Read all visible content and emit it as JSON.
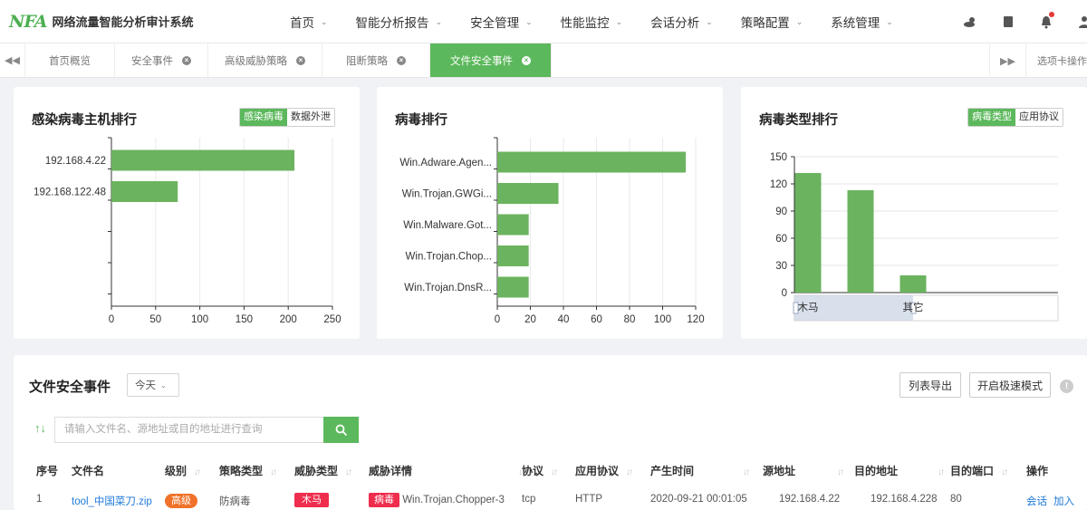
{
  "app": {
    "logo_mark": "NFA",
    "title": "网络流量智能分析审计系统"
  },
  "nav": [
    {
      "label": "首页"
    },
    {
      "label": "智能分析报告"
    },
    {
      "label": "安全管理"
    },
    {
      "label": "性能监控"
    },
    {
      "label": "会话分析"
    },
    {
      "label": "策略配置"
    },
    {
      "label": "系统管理"
    }
  ],
  "tabs": [
    {
      "label": "首页概览",
      "closable": false
    },
    {
      "label": "安全事件",
      "closable": true
    },
    {
      "label": "高级威胁策略",
      "closable": true
    },
    {
      "label": "阻断策略",
      "closable": true
    },
    {
      "label": "文件安全事件",
      "closable": true,
      "active": true
    }
  ],
  "tab_options_label": "选项卡操作",
  "accent": "#5cb85c",
  "cards": {
    "hosts": {
      "title": "感染病毒主机排行",
      "toggle": [
        "感染病毒",
        "数据外泄"
      ]
    },
    "virus": {
      "title": "病毒排行"
    },
    "types": {
      "title": "病毒类型排行",
      "toggle": [
        "病毒类型",
        "应用协议"
      ]
    }
  },
  "chart_data": [
    {
      "type": "bar",
      "orientation": "horizontal",
      "categories": [
        "192.168.4.22",
        "192.168.122.48"
      ],
      "values": [
        207,
        75
      ],
      "xlim": [
        0,
        250
      ],
      "xticks": [
        "0",
        "50",
        "100",
        "150",
        "200",
        "250"
      ],
      "color": "#6bb35e"
    },
    {
      "type": "bar",
      "orientation": "horizontal",
      "categories": [
        "Win.Adware.Agen...",
        "Win.Trojan.GWGi...",
        "Win.Malware.Got...",
        "Win.Trojan.Chop...",
        "Win.Trojan.DnsR..."
      ],
      "values": [
        114,
        37,
        19,
        19,
        19
      ],
      "xlim": [
        0,
        120
      ],
      "xticks": [
        "0",
        "20",
        "40",
        "60",
        "80",
        "100",
        "120"
      ],
      "color": "#6bb35e"
    },
    {
      "type": "bar",
      "orientation": "vertical",
      "categories": [
        "木马",
        "其它"
      ],
      "values": [
        132,
        113,
        19
      ],
      "ylim": [
        0,
        150
      ],
      "yticks": [
        "0",
        "30",
        "60",
        "90",
        "120",
        "150"
      ],
      "color": "#6bb35e"
    }
  ],
  "events": {
    "title": "文件安全事件",
    "period": "今天",
    "export_label": "列表导出",
    "fast_mode_label": "开启极速模式",
    "info_label": "!",
    "sort_icon_label": "↑↓",
    "search_placeholder": "请输入文件名、源地址或目的地址进行查询",
    "columns": [
      "序号",
      "文件名",
      "级别",
      "策略类型",
      "威胁类型",
      "威胁详情",
      "协议",
      "应用协议",
      "产生时间",
      "源地址",
      "目的地址",
      "目的端口",
      "操作"
    ],
    "rows": [
      {
        "index": "1",
        "file_name": "tool_中国菜刀.zip",
        "level": "高级",
        "policy_type": "防病毒",
        "threat_type": "木马",
        "threat_tag": "病毒",
        "threat_detail": "Win.Trojan.Chopper-3",
        "protocol": "tcp",
        "app_protocol": "HTTP",
        "time": "2020-09-21 00:01:05",
        "src": "192.168.4.22",
        "dst": "192.168.4.228",
        "port": "80",
        "action_session": "会话",
        "action_add": "加入"
      }
    ]
  }
}
